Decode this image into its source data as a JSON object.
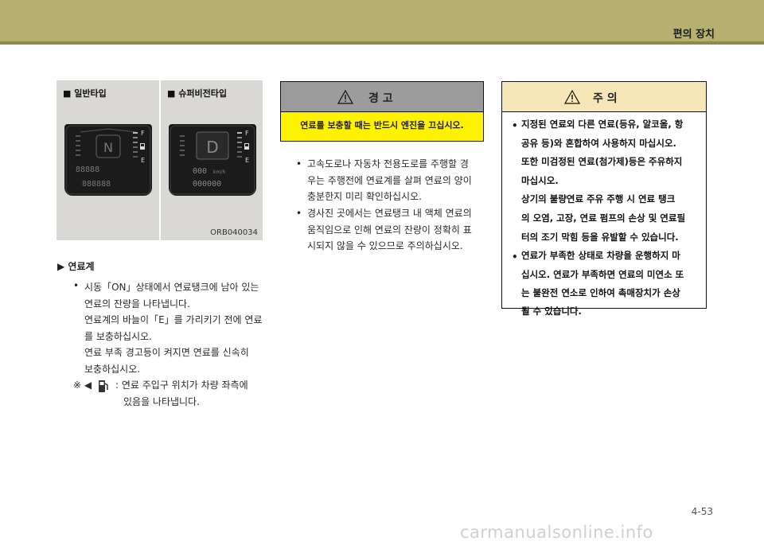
{
  "header": {
    "title": "편의 장치"
  },
  "figure": {
    "left_label": "■ 일반타입",
    "right_label": "■ 슈퍼비전타입",
    "code": "ORB040034",
    "cluster_left": {
      "gear": "N",
      "fuel_full": "F",
      "fuel_empty": "E",
      "odometer": "88888",
      "trip": "888888"
    },
    "cluster_right": {
      "gear": "D",
      "fuel_full": "F",
      "fuel_empty": "E",
      "speed": "000",
      "speed_unit": "km/h",
      "odometer": "000000"
    }
  },
  "section": {
    "marker": "▶",
    "title": "연료계",
    "bullet": "•",
    "lines": [
      "시동「ON」상태에서 연료탱크에 남아 있는",
      "연료의 잔량을 나타냅니다.",
      "연료계의 바늘이「E」를 가리키기 전에 연료",
      "를 보충하십시오.",
      "연료 부족 경고등이 켜지면 연료를 신속히",
      "보충하십시오."
    ],
    "note_mark": "※ ◀",
    "note_lines": [
      ": 연료 주입구 위치가 차량 좌측에",
      "있음을 나타냅니다."
    ]
  },
  "warning": {
    "title": "경  고",
    "body": "연료를 보충할 때는 반드시 엔진을 끄십시오.",
    "items": [
      [
        "고속도로나 자동차 전용도로를 주행할 경",
        "우는 주행전에 연료계를 살펴 연료의 양이",
        "충분한지 미리 확인하십시오."
      ],
      [
        "경사진 곳에서는 연료탱크 내 액체 연료의",
        "움직임으로 인해 연료의 잔량이 정확히 표",
        "시되지 않을 수 있으므로 주의하십시오."
      ]
    ]
  },
  "caution": {
    "title": "주  의",
    "items": [
      [
        "지정된 연료외 다른 연료(등유, 알코올, 항",
        "공유 등)와 혼합하여 사용하지 마십시오.",
        "또한 미검정된 연료(첨가제)등은 주유하지",
        "마십시오.",
        "상기의 불량연료 주유 주행 시 연료 탱크",
        "의 오염, 고장, 연료 펌프의 손상 및 연료필",
        "터의 조기 막힘 등을 유발할 수 있습니다."
      ],
      [
        "연료가 부족한 상태로 차량을 운행하지 마",
        "십시오. 연료가 부족하면 연료의 미연소 또",
        "는 불완전 연소로 인하여 촉매장치가 손상",
        "될 수 있습니다."
      ]
    ]
  },
  "page_number": "4-53",
  "watermark": "carmanualsonline.info",
  "colors": {
    "header_band": "#b5b06f",
    "warning_fill": "#fff200",
    "caution_head": "#f7e7b8"
  }
}
